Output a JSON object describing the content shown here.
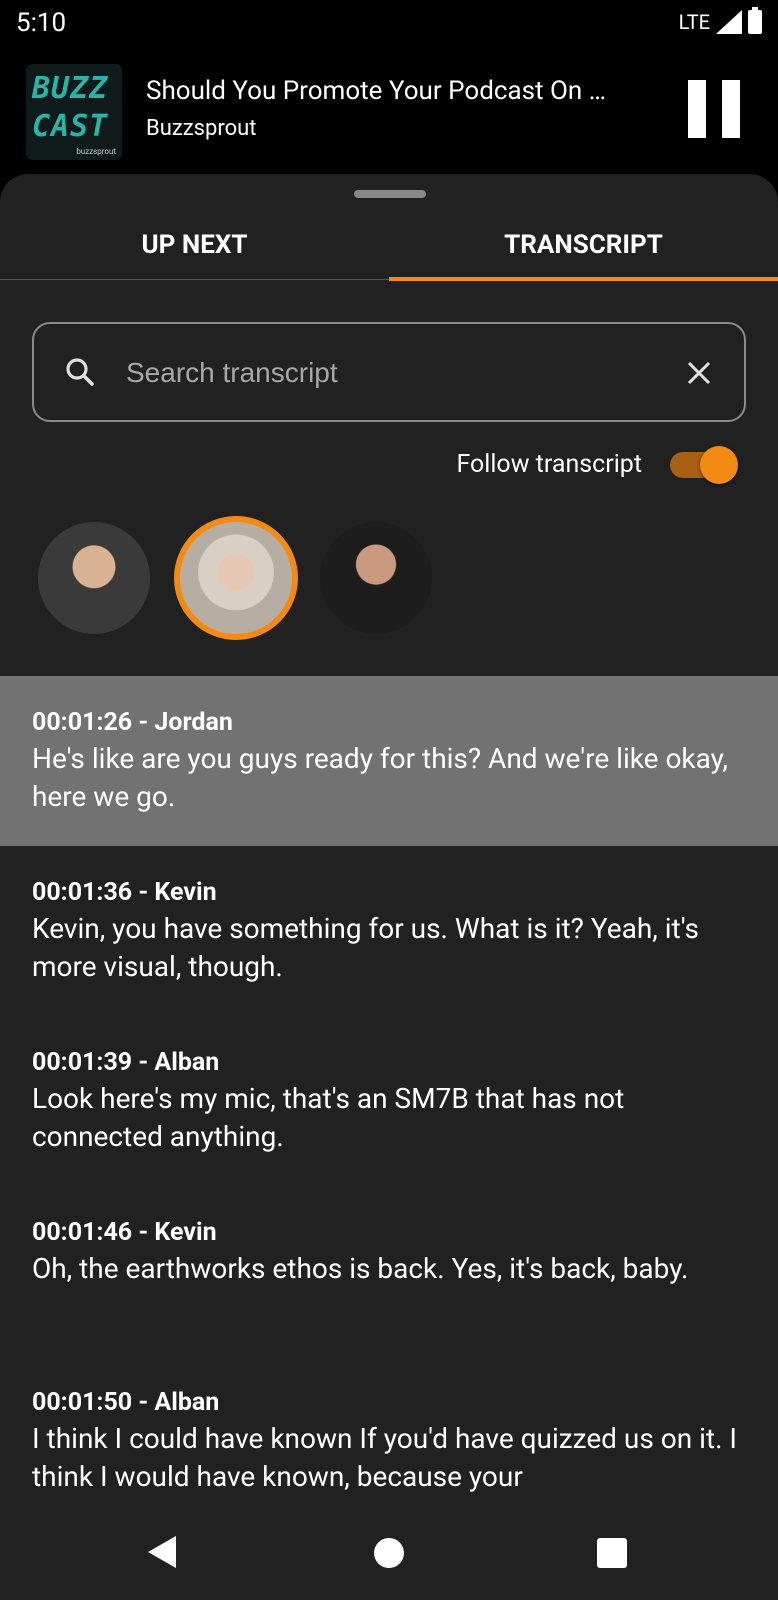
{
  "status_bar": {
    "time": "5:10",
    "network": "LTE"
  },
  "player": {
    "artwork_text": "BUZZ CAST",
    "artwork_brand": "buzzsprout",
    "episode_title": "Should You Promote Your Podcast On …",
    "podcast_name": "Buzzsprout",
    "state": "playing"
  },
  "tabs": [
    {
      "label": "UP NEXT",
      "selected": false
    },
    {
      "label": "TRANSCRIPT",
      "selected": true
    }
  ],
  "search": {
    "placeholder": "Search transcript",
    "value": ""
  },
  "follow": {
    "label": "Follow transcript",
    "enabled": true
  },
  "speakers": [
    {
      "name": "Jordan",
      "active": false
    },
    {
      "name": "Alban",
      "active": true
    },
    {
      "name": "Kevin",
      "active": false
    }
  ],
  "transcript": [
    {
      "meta": "00:01:26 - Jordan",
      "text": "He's like are you guys ready for this? And we're like okay, here we go.",
      "active": true
    },
    {
      "meta": "00:01:36 - Kevin",
      "text": "Kevin, you have something for us. What is it? Yeah, it's more visual, though.",
      "active": false
    },
    {
      "meta": "00:01:39 - Alban",
      "text": "Look here's my mic, that's an SM7B that has not connected anything.",
      "active": false
    },
    {
      "meta": "00:01:46 - Kevin",
      "text": "Oh, the earthworks ethos is back. Yes, it's back, baby.",
      "active": false
    },
    {
      "meta": "00:01:50 - Alban",
      "text": "I think I could have known If you'd have quizzed us on it. I think I would have known, because your",
      "active": false
    }
  ],
  "colors": {
    "accent": "#f28a13",
    "sheet_bg": "#212121",
    "active_row_bg": "#727272"
  }
}
